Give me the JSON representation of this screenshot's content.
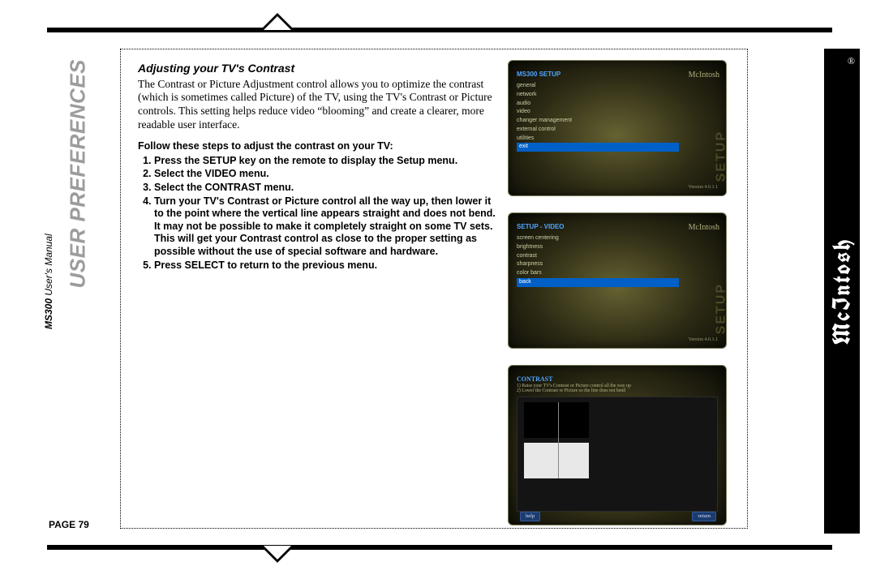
{
  "brand": "McIntosh",
  "chapter": "USER PREFERENCES",
  "manual_bold": "MS300",
  "manual_rest": " User's Manual",
  "page_label": "PAGE 79",
  "section_title": "Adjusting your TV's Contrast",
  "body": "The Contrast or Picture Adjustment control allows you to optimize the contrast (which is sometimes called Picture) of the TV, using the TV's Contrast or Picture controls. This setting helps reduce video “blooming” and create a clearer, more readable user interface.",
  "steps_label": "Follow these steps to adjust the contrast on your TV:",
  "steps": [
    "Press the SETUP key on the remote to display the Setup menu.",
    "Select the VIDEO menu.",
    "Select the CONTRAST menu.",
    "Turn your TV's Contrast or Picture control all the way up, then lower it to the point where the vertical line appears straight and does not bend. It may not be possible to make it completely straight on some TV sets. This will get your Contrast control as close to the proper setting as possible without the use of special software and hardware.",
    "Press SELECT to return to the previous menu."
  ],
  "shot1": {
    "title": "MS300 SETUP",
    "items": [
      "general",
      "network",
      "audio",
      "video",
      "changer management",
      "external control",
      "utilities",
      "exit"
    ],
    "selected_index": 7,
    "side": "SETUP",
    "version": "Version 4.0.1.1"
  },
  "shot2": {
    "title": "SETUP - VIDEO",
    "items": [
      "screen centering",
      "brightness",
      "contrast",
      "sharpness",
      "color bars",
      "back"
    ],
    "selected_index": 5,
    "side": "SETUP",
    "version": "Version 4.0.1.1"
  },
  "shot3": {
    "title": "CONTRAST",
    "line1": "1) Raise your TV's Contrast or Picture control all the way up",
    "line2": "2) Lower the Contrast or Picture so the line does not bend",
    "help": "help",
    "return": "return"
  }
}
